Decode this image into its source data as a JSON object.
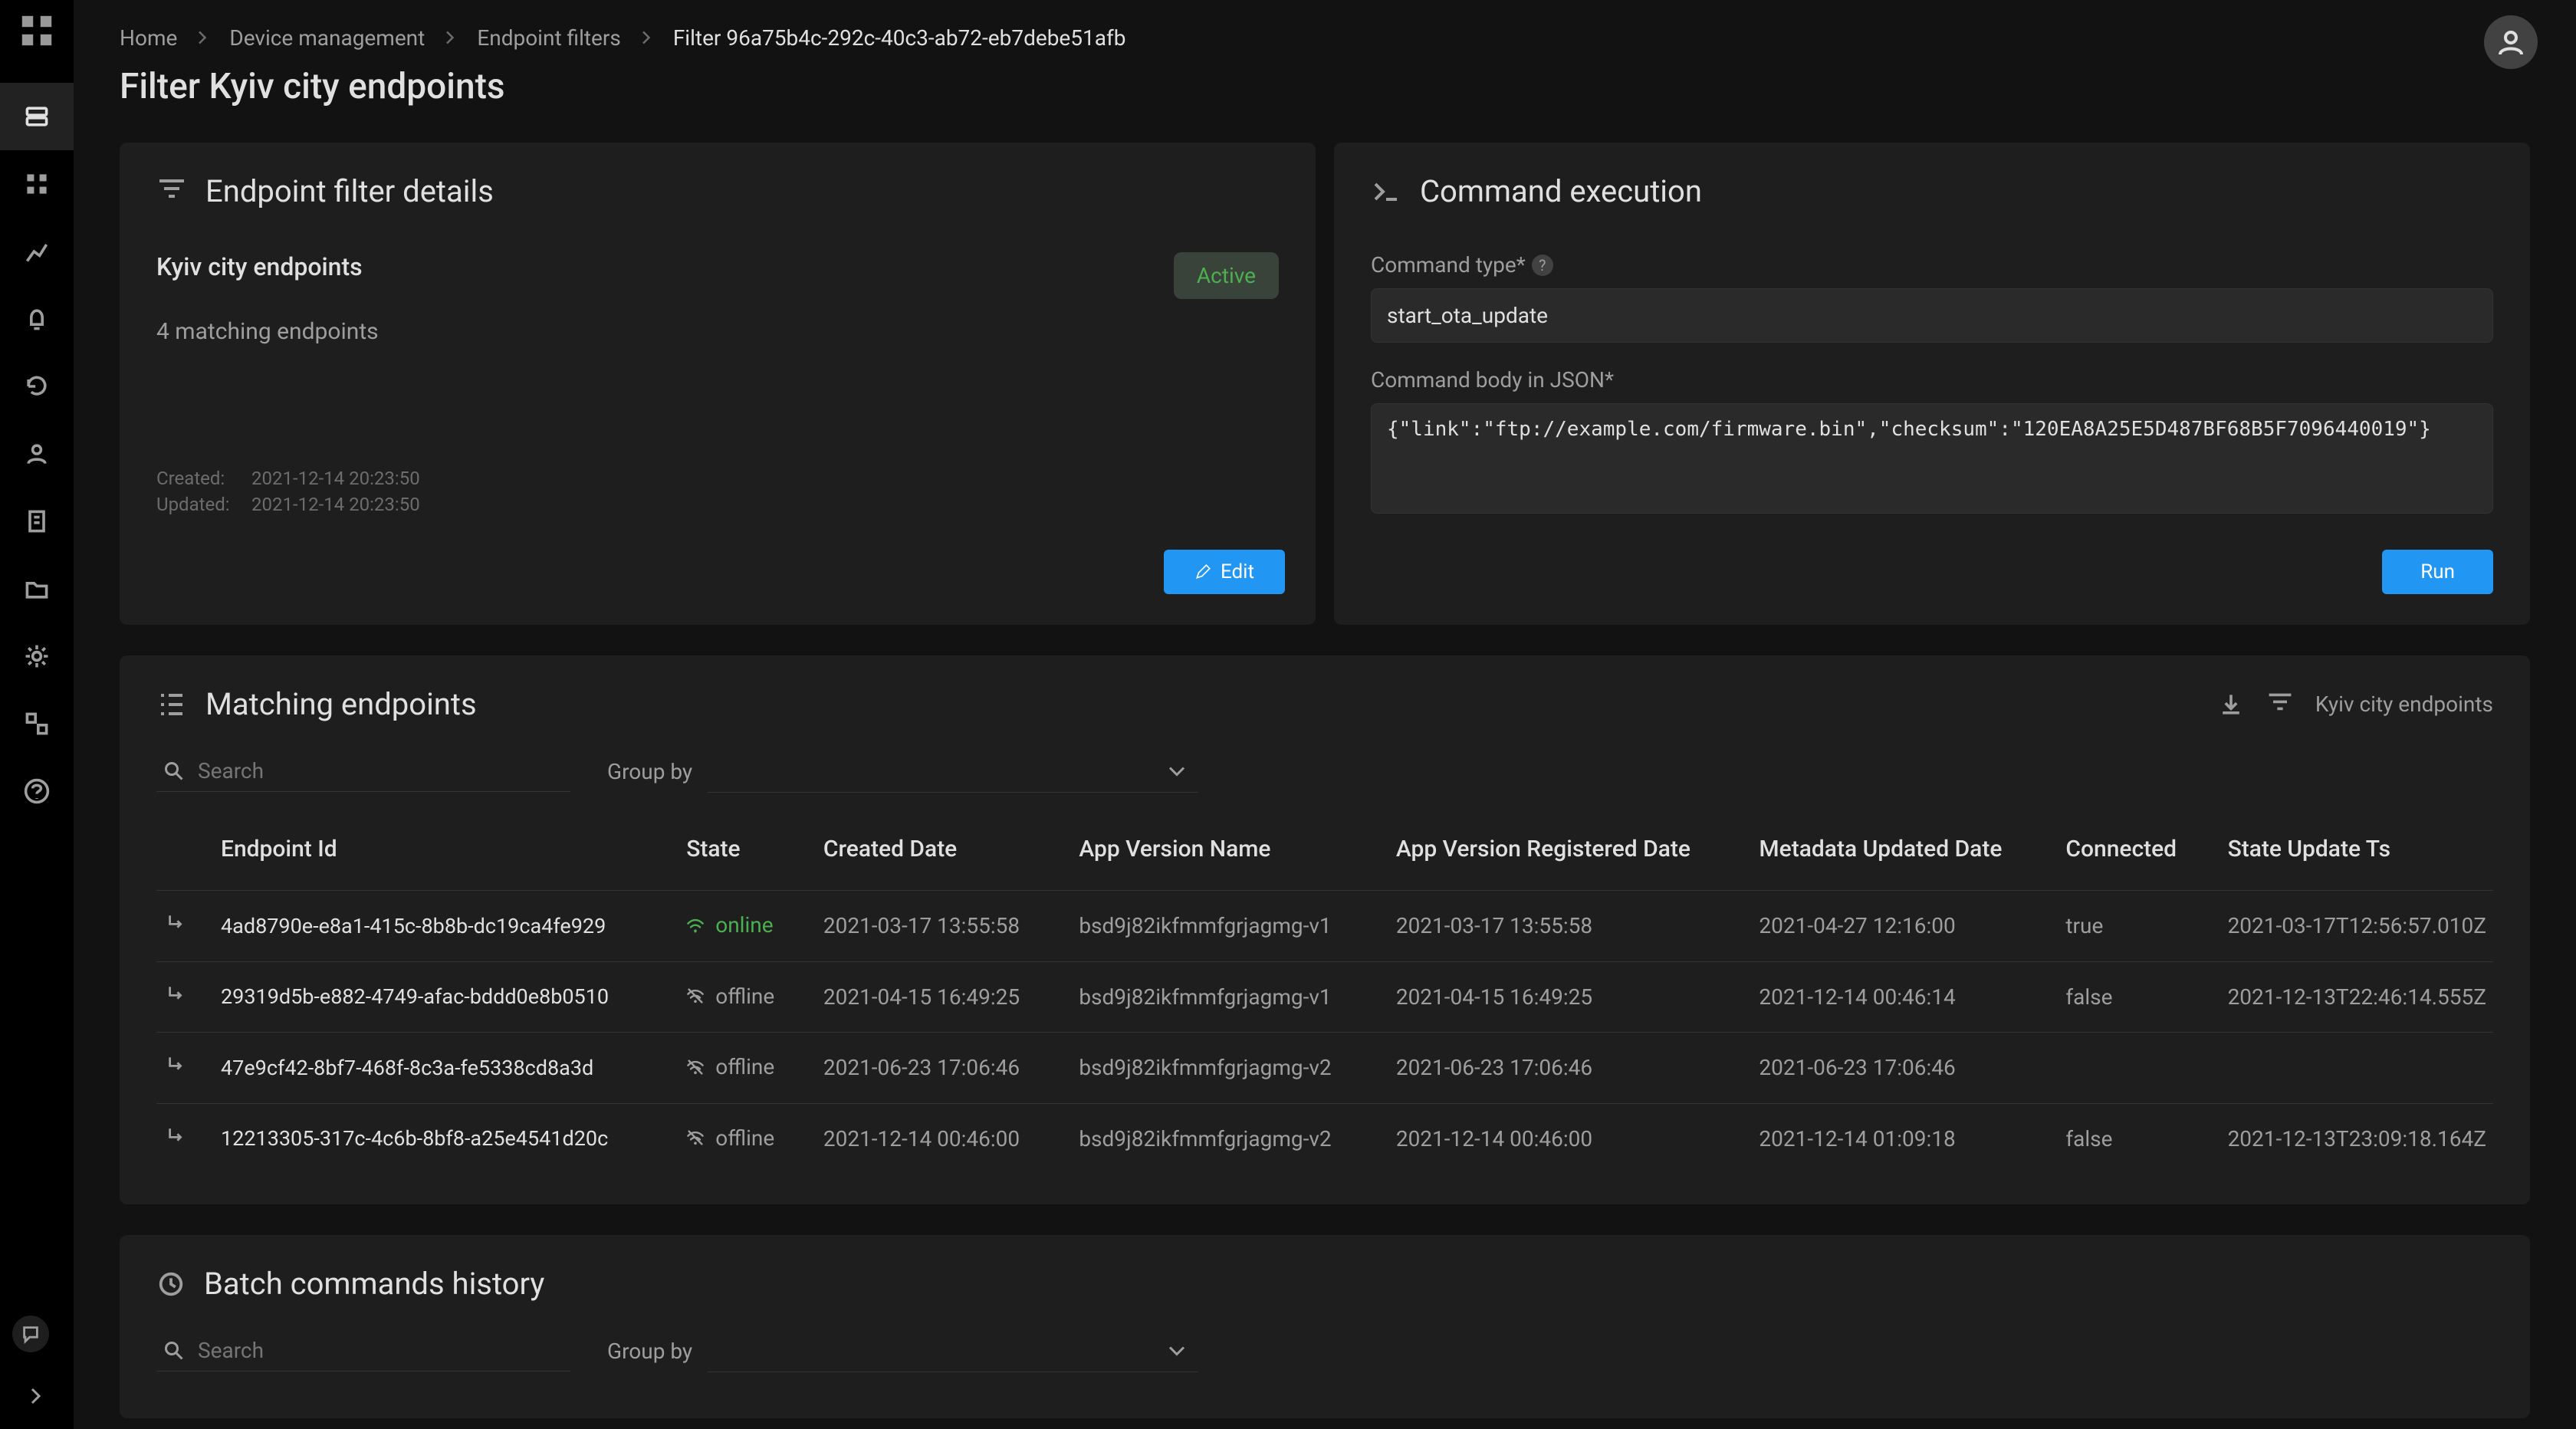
{
  "breadcrumbs": {
    "home": "Home",
    "device_management": "Device management",
    "endpoint_filters": "Endpoint filters",
    "current": "Filter 96a75b4c-292c-40c3-ab72-eb7debe51afb"
  },
  "page_title": "Filter Kyiv city endpoints",
  "filter_details": {
    "panel_title": "Endpoint filter details",
    "name": "Kyiv city endpoints",
    "matching_count_text": "4 matching endpoints",
    "status_label": "Active",
    "created_label": "Created:",
    "created_value": "2021-12-14 20:23:50",
    "updated_label": "Updated:",
    "updated_value": "2021-12-14 20:23:50",
    "edit_label": "Edit"
  },
  "command_exec": {
    "panel_title": "Command execution",
    "type_label": "Command type*",
    "type_value": "start_ota_update",
    "body_label": "Command body in JSON*",
    "body_value": "{\"link\":\"ftp://example.com/firmware.bin\",\"checksum\":\"120EA8A25E5D487BF68B5F7096440019\"}",
    "run_label": "Run"
  },
  "matching": {
    "panel_title": "Matching endpoints",
    "filter_chip": "Kyiv city endpoints",
    "search_placeholder": "Search",
    "group_by_label": "Group by",
    "columns": {
      "endpoint_id": "Endpoint Id",
      "state": "State",
      "created_date": "Created Date",
      "app_version_name": "App Version Name",
      "app_version_registered_date": "App Version Registered Date",
      "metadata_updated_date": "Metadata Updated Date",
      "connected": "Connected",
      "state_update_ts": "State Update Ts"
    },
    "state_online": "online",
    "state_offline": "offline",
    "rows": [
      {
        "endpoint_id": "4ad8790e-e8a1-415c-8b8b-dc19ca4fe929",
        "state": "online",
        "created_date": "2021-03-17 13:55:58",
        "app_version_name": "bsd9j82ikfmmfgrjagmg-v1",
        "app_version_registered_date": "2021-03-17 13:55:58",
        "metadata_updated_date": "2021-04-27 12:16:00",
        "connected": "true",
        "state_update_ts": "2021-03-17T12:56:57.010Z"
      },
      {
        "endpoint_id": "29319d5b-e882-4749-afac-bddd0e8b0510",
        "state": "offline",
        "created_date": "2021-04-15 16:49:25",
        "app_version_name": "bsd9j82ikfmmfgrjagmg-v1",
        "app_version_registered_date": "2021-04-15 16:49:25",
        "metadata_updated_date": "2021-12-14 00:46:14",
        "connected": "false",
        "state_update_ts": "2021-12-13T22:46:14.555Z"
      },
      {
        "endpoint_id": "47e9cf42-8bf7-468f-8c3a-fe5338cd8a3d",
        "state": "offline",
        "created_date": "2021-06-23 17:06:46",
        "app_version_name": "bsd9j82ikfmmfgrjagmg-v2",
        "app_version_registered_date": "2021-06-23 17:06:46",
        "metadata_updated_date": "2021-06-23 17:06:46",
        "connected": "",
        "state_update_ts": ""
      },
      {
        "endpoint_id": "12213305-317c-4c6b-8bf8-a25e4541d20c",
        "state": "offline",
        "created_date": "2021-12-14 00:46:00",
        "app_version_name": "bsd9j82ikfmmfgrjagmg-v2",
        "app_version_registered_date": "2021-12-14 00:46:00",
        "metadata_updated_date": "2021-12-14 01:09:18",
        "connected": "false",
        "state_update_ts": "2021-12-13T23:09:18.164Z"
      }
    ]
  },
  "batch_history": {
    "panel_title": "Batch commands history",
    "search_placeholder": "Search",
    "group_by_label": "Group by"
  }
}
